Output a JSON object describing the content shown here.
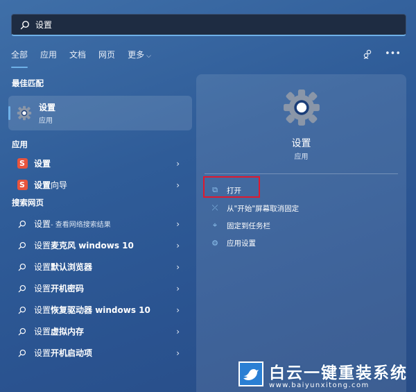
{
  "search": {
    "value": "设置"
  },
  "tabs": [
    {
      "label": "全部",
      "active": true
    },
    {
      "label": "应用"
    },
    {
      "label": "文档"
    },
    {
      "label": "网页"
    },
    {
      "label": "更多"
    }
  ],
  "sections": {
    "best_match": "最佳匹配",
    "apps": "应用",
    "web": "搜索网页"
  },
  "best_match": {
    "name": "设置",
    "type": "应用"
  },
  "apps": [
    {
      "label_bold": "设置",
      "label_rest": ""
    },
    {
      "label_bold": "设置",
      "label_rest": "向导"
    }
  ],
  "web_results": [
    {
      "prefix": "设置",
      "bold": "",
      "suffix": " - 查看网络搜索结果"
    },
    {
      "prefix": "设置",
      "bold": "麦克风 windows 10",
      "suffix": ""
    },
    {
      "prefix": "设置",
      "bold": "默认浏览器",
      "suffix": ""
    },
    {
      "prefix": "设置",
      "bold": "开机密码",
      "suffix": ""
    },
    {
      "prefix": "设置",
      "bold": "恢复驱动器 windows 10",
      "suffix": ""
    },
    {
      "prefix": "设置",
      "bold": "虚拟内存",
      "suffix": ""
    },
    {
      "prefix": "设置",
      "bold": "开机启动项",
      "suffix": ""
    }
  ],
  "detail": {
    "title": "设置",
    "subtitle": "应用",
    "actions": [
      {
        "label": "打开",
        "icon": "open-external-icon"
      },
      {
        "label": "从\"开始\"屏幕取消固定",
        "icon": "unpin-icon"
      },
      {
        "label": "固定到任务栏",
        "icon": "pin-icon"
      },
      {
        "label": "应用设置",
        "icon": "gear-icon"
      }
    ]
  },
  "watermark": {
    "main": "白云一键重装系统",
    "url": "www.baiyunxitong.com"
  },
  "colors": {
    "accent": "#6fb1e8",
    "highlight": "#e0192e",
    "sogou": "#e8543d"
  }
}
